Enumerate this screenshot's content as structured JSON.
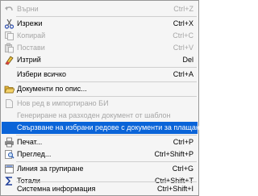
{
  "menu": {
    "undo": {
      "label": "Върни",
      "shortcut": "Ctrl+Z",
      "icon": "undo-arrow-icon"
    },
    "cut": {
      "label": "Изрежи",
      "shortcut": "Ctrl+X",
      "icon": "scissors-icon"
    },
    "copy": {
      "label": "Копирай",
      "shortcut": "Ctrl+C",
      "icon": "copy-icon"
    },
    "paste": {
      "label": "Постави",
      "shortcut": "Ctrl+V",
      "icon": "paste-icon"
    },
    "delete": {
      "label": "Изтрий",
      "shortcut": "Del",
      "icon": "eraser-icon"
    },
    "select_all": {
      "label": "Избери всичко",
      "shortcut": "Ctrl+A"
    },
    "documents_by_list": {
      "label": "Документи по опис...",
      "icon": "folder-open-icon"
    },
    "new_row_imported": {
      "label": "Нов ред в импортирано БИ",
      "icon": "new-document-icon"
    },
    "generate_expense": {
      "label": "Генериране на разходен документ от шаблон"
    },
    "link_rows_payments": {
      "label": "Свързване на избрани редове с документи за плащане..."
    },
    "print": {
      "label": "Печат...",
      "shortcut": "Ctrl+P",
      "icon": "printer-icon"
    },
    "preview": {
      "label": "Преглед...",
      "shortcut": "Ctrl+Shift+P",
      "icon": "print-preview-icon"
    },
    "grouping_line": {
      "label": "Линия за групиране",
      "shortcut": "Ctrl+G",
      "icon": "grouping-icon"
    },
    "totals": {
      "label": "Тотали",
      "shortcut": "Ctrl+Shift+T",
      "icon": "sigma-icon"
    },
    "system_info": {
      "label": "Системна информация",
      "shortcut": "Ctrl+Shift+I"
    }
  },
  "colors": {
    "highlight": "#0a64d8",
    "disabled_text": "#a6a6a6",
    "background": "#f5f5f5"
  }
}
